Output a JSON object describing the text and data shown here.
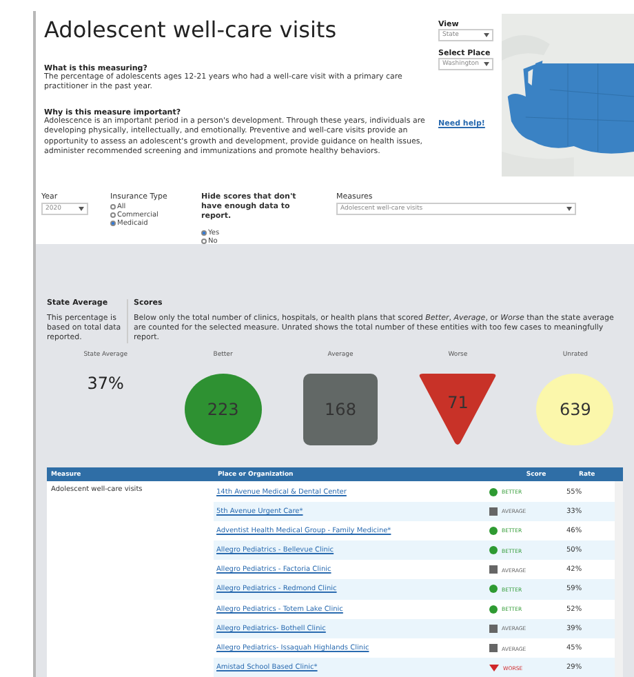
{
  "title": "Adolescent well-care visits",
  "about": [
    {
      "heading": "What is this measuring?",
      "text": "The percentage of adolescents ages 12-21 years who had a well-care visit with a primary care practitioner in the past year."
    },
    {
      "heading": "Why is this measure important?",
      "text": "Adolescence is an important period in a person's development. Through these years, individuals are developing physically, intellectually, and emotionally. Preventive and well-care visits provide an opportunity to assess an adolescent's growth and development, provide guidance on health issues, administer recommended screening and immunizations and promote healthy behaviors."
    }
  ],
  "view": {
    "label": "View",
    "value": "State"
  },
  "place": {
    "label": "Select Place",
    "value": "Washington"
  },
  "help_link": "Need help!",
  "year": {
    "label": "Year",
    "value": "2020"
  },
  "insurance": {
    "label": "Insurance Type",
    "options": [
      {
        "label": "All",
        "selected": false
      },
      {
        "label": "Commercial",
        "selected": false
      },
      {
        "label": "Medicaid",
        "selected": true
      }
    ]
  },
  "hide": {
    "label": "Hide scores that don't have enough data to report.",
    "options": [
      {
        "label": "Yes",
        "selected": true
      },
      {
        "label": "No",
        "selected": false
      }
    ]
  },
  "measures": {
    "label": "Measures",
    "value": "Adolescent well-care visits"
  },
  "state_average": {
    "heading": "State Average",
    "text": "This percentage is based on total data reported."
  },
  "scores": {
    "heading": "Scores",
    "text": "Below only the total number of clinics, hospitals, or health plans that scored *Better*, *Average*, or *Worse* than the state average are counted for the selected measure. Unrated shows the total number of these entities with too few cases to meaningfully report."
  },
  "summary": [
    {
      "kind": "text",
      "label": "State Average",
      "value": "37%"
    },
    {
      "kind": "circle",
      "label": "Better",
      "value": "223",
      "color": "#2e9132"
    },
    {
      "kind": "square",
      "label": "Average",
      "value": "168",
      "color": "#626866"
    },
    {
      "kind": "triangle",
      "label": "Worse",
      "value": "71",
      "color": "#c83228"
    },
    {
      "kind": "circle",
      "label": "Unrated",
      "value": "639",
      "color": "#fbf7ab"
    }
  ],
  "table": {
    "columns": [
      "Measure",
      "Place or Organization",
      "Score",
      "Rate"
    ],
    "measure": "Adolescent well-care visits",
    "rows": [
      {
        "place": "14th Avenue Medical & Dental Center",
        "score": "BETTER",
        "kind": "better",
        "rate": "55%"
      },
      {
        "place": "5th Avenue Urgent Care*",
        "score": "AVERAGE",
        "kind": "average",
        "rate": "33%"
      },
      {
        "place": "Adventist Health Medical Group - Family Medicine*",
        "score": "BETTER",
        "kind": "better",
        "rate": "46%"
      },
      {
        "place": "Allegro Pediatrics - Bellevue Clinic",
        "score": "BETTER",
        "kind": "better",
        "rate": "50%"
      },
      {
        "place": "Allegro Pediatrics - Factoria Clinic",
        "score": "AVERAGE",
        "kind": "average",
        "rate": "42%"
      },
      {
        "place": "Allegro Pediatrics - Redmond Clinic",
        "score": "BETTER",
        "kind": "better",
        "rate": "59%"
      },
      {
        "place": "Allegro Pediatrics - Totem Lake Clinic",
        "score": "BETTER",
        "kind": "better",
        "rate": "52%"
      },
      {
        "place": "Allegro Pediatrics- Bothell Clinic",
        "score": "AVERAGE",
        "kind": "average",
        "rate": "39%"
      },
      {
        "place": "Allegro Pediatrics- Issaquah Highlands Clinic",
        "score": "AVERAGE",
        "kind": "average",
        "rate": "45%"
      },
      {
        "place": "Amistad School Based Clinic*",
        "score": "WORSE",
        "kind": "worse",
        "rate": "29%"
      }
    ]
  }
}
